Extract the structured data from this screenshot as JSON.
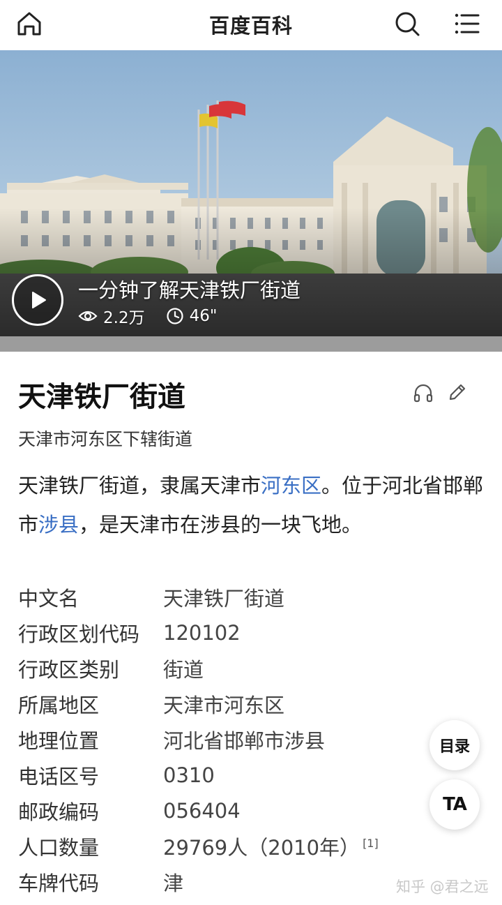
{
  "header": {
    "title": "百度百科",
    "icons": [
      "home-icon",
      "search-icon",
      "menu-icon"
    ]
  },
  "video": {
    "title": "一分钟了解天津铁厂街道",
    "views": "2.2万",
    "duration": "46\""
  },
  "article": {
    "title": "天津铁厂街道",
    "subtitle": "天津市河东区下辖街道",
    "summary": {
      "part1": "天津铁厂街道，隶属天津市",
      "link1": "河东区",
      "part2": "。位于河北省邯郸市",
      "link2": "涉县",
      "part3": "，是天津市在涉县的一块飞地。"
    }
  },
  "info": [
    {
      "key": "中文名",
      "value": "天津铁厂街道"
    },
    {
      "key": "行政区划代码",
      "value": "120102"
    },
    {
      "key": "行政区类别",
      "value": "街道"
    },
    {
      "key": "所属地区",
      "value": "天津市河东区"
    },
    {
      "key": "地理位置",
      "value": "河北省邯郸市涉县"
    },
    {
      "key": "电话区号",
      "value": "0310"
    },
    {
      "key": "邮政编码",
      "value": "056404"
    },
    {
      "key": "人口数量",
      "value": "29769人（2010年）",
      "ref": "[1]"
    },
    {
      "key": "车牌代码",
      "value": "津"
    }
  ],
  "floating": {
    "toc": "目录",
    "ta": "TA"
  },
  "watermark": "知乎 @君之远",
  "colors": {
    "link": "#3a6fc4",
    "sky": "#8fb3d3",
    "building": "#ece7dc"
  }
}
